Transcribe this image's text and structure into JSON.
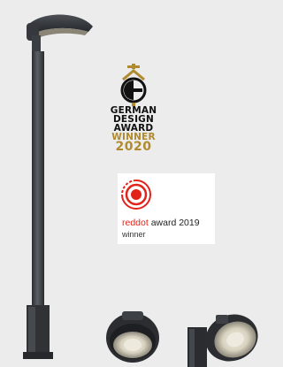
{
  "german_design_award": {
    "line1": "GERMAN",
    "line2": "DESIGN",
    "line3": "AWARD",
    "line4": "WINNER",
    "year": "2020",
    "accent_color": "#b08a2e"
  },
  "reddot_award": {
    "brand_red": "reddot",
    "award_text": " award 2019",
    "winner": "winner",
    "accent_color": "#e2231a"
  },
  "icons": [
    "street-lamp-photo",
    "gda-logo-icon",
    "reddot-logo-icon",
    "luminaire-round-photo",
    "luminaire-tilted-photo"
  ]
}
